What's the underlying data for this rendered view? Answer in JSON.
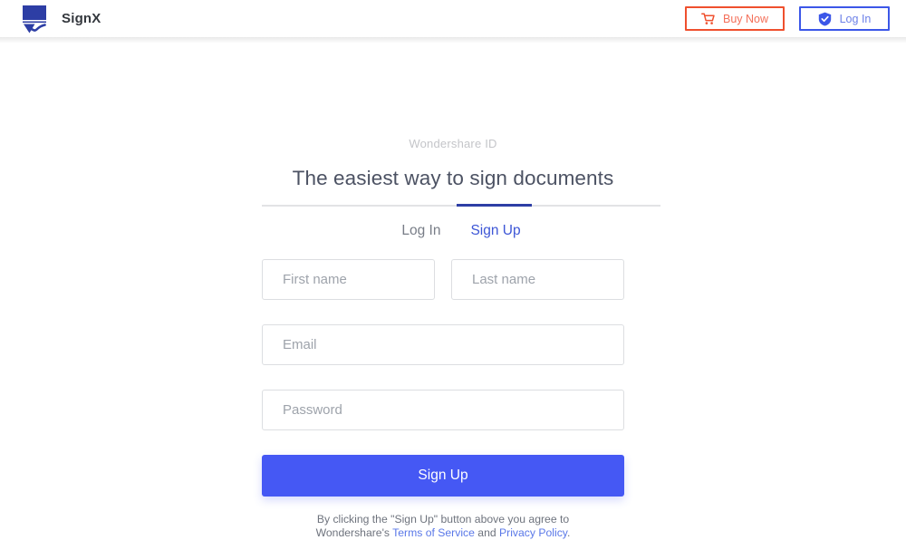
{
  "header": {
    "brand_name": "SignX",
    "logo_icon": "signx-logo-icon",
    "buttons": {
      "buy": {
        "label": "Buy Now",
        "icon": "shopping-cart-icon",
        "border_color": "#ef502e",
        "text_color": "#f4705a"
      },
      "login": {
        "label": "Log In",
        "icon": "shield-check-icon",
        "border_color": "#3c57e8",
        "text_color": "#6d81e8"
      }
    }
  },
  "main": {
    "eyebrow": "Wondershare ID",
    "headline": "The easiest way to sign documents",
    "tabs": [
      {
        "label": "Log In",
        "active": false
      },
      {
        "label": "Sign Up",
        "active": true
      }
    ],
    "active_tab_color": "#3d56d6",
    "form": {
      "first_name": {
        "placeholder": "First name",
        "value": ""
      },
      "last_name": {
        "placeholder": "Last name",
        "value": ""
      },
      "email": {
        "placeholder": "Email",
        "value": ""
      },
      "password": {
        "placeholder": "Password",
        "value": ""
      },
      "submit_label": "Sign Up",
      "submit_color": "#4558f4"
    },
    "legal": {
      "line1_before": "By clicking the \"Sign Up\" button above you agree to",
      "line2_before": "Wondershare's ",
      "terms_label": "Terms of Service",
      "conjunction": " and ",
      "privacy_label": "Privacy Policy",
      "period": ".",
      "link_color": "#5a78e8"
    }
  }
}
